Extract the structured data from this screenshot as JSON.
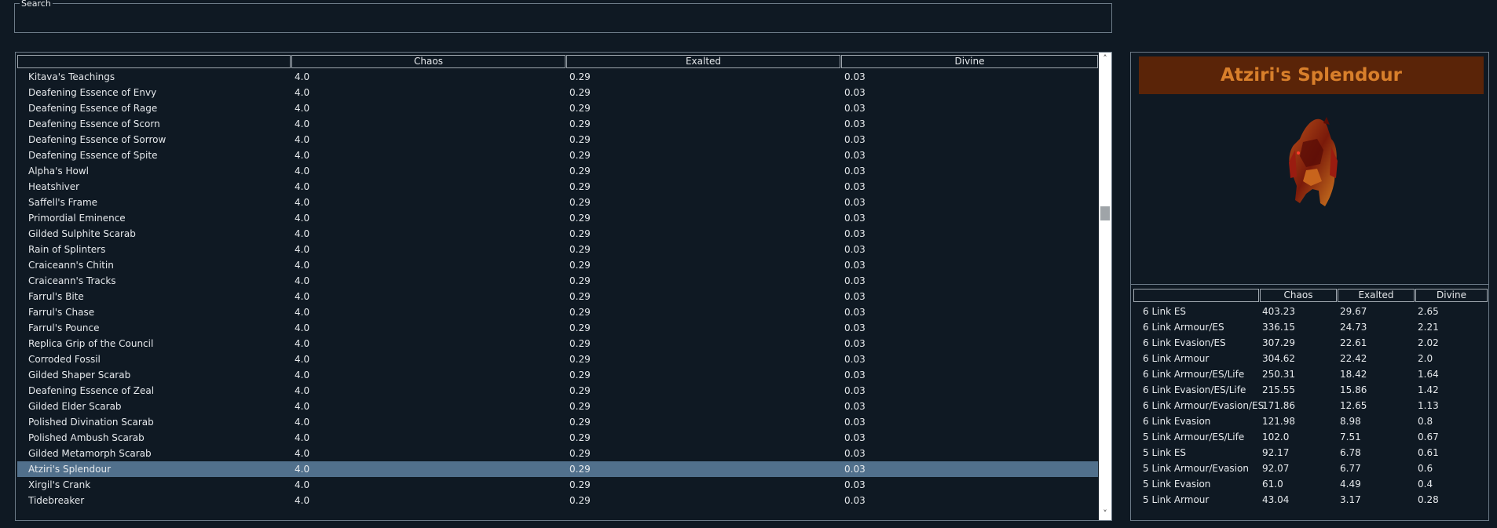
{
  "search": {
    "label": "Search",
    "value": ""
  },
  "main_table": {
    "columns": [
      "",
      "Chaos",
      "Exalted",
      "Divine"
    ],
    "rows": [
      {
        "name": "Kitava's Teachings",
        "chaos": "4.0",
        "exalted": "0.29",
        "divine": "0.03"
      },
      {
        "name": "Deafening Essence of Envy",
        "chaos": "4.0",
        "exalted": "0.29",
        "divine": "0.03"
      },
      {
        "name": "Deafening Essence of Rage",
        "chaos": "4.0",
        "exalted": "0.29",
        "divine": "0.03"
      },
      {
        "name": "Deafening Essence of Scorn",
        "chaos": "4.0",
        "exalted": "0.29",
        "divine": "0.03"
      },
      {
        "name": "Deafening Essence of Sorrow",
        "chaos": "4.0",
        "exalted": "0.29",
        "divine": "0.03"
      },
      {
        "name": "Deafening Essence of Spite",
        "chaos": "4.0",
        "exalted": "0.29",
        "divine": "0.03"
      },
      {
        "name": "Alpha's Howl",
        "chaos": "4.0",
        "exalted": "0.29",
        "divine": "0.03"
      },
      {
        "name": "Heatshiver",
        "chaos": "4.0",
        "exalted": "0.29",
        "divine": "0.03"
      },
      {
        "name": "Saffell's Frame",
        "chaos": "4.0",
        "exalted": "0.29",
        "divine": "0.03"
      },
      {
        "name": "Primordial Eminence",
        "chaos": "4.0",
        "exalted": "0.29",
        "divine": "0.03"
      },
      {
        "name": "Gilded Sulphite Scarab",
        "chaos": "4.0",
        "exalted": "0.29",
        "divine": "0.03"
      },
      {
        "name": "Rain of Splinters",
        "chaos": "4.0",
        "exalted": "0.29",
        "divine": "0.03"
      },
      {
        "name": "Craiceann's Chitin",
        "chaos": "4.0",
        "exalted": "0.29",
        "divine": "0.03"
      },
      {
        "name": "Craiceann's Tracks",
        "chaos": "4.0",
        "exalted": "0.29",
        "divine": "0.03"
      },
      {
        "name": "Farrul's Bite",
        "chaos": "4.0",
        "exalted": "0.29",
        "divine": "0.03"
      },
      {
        "name": "Farrul's Chase",
        "chaos": "4.0",
        "exalted": "0.29",
        "divine": "0.03"
      },
      {
        "name": "Farrul's Pounce",
        "chaos": "4.0",
        "exalted": "0.29",
        "divine": "0.03"
      },
      {
        "name": "Replica Grip of the Council",
        "chaos": "4.0",
        "exalted": "0.29",
        "divine": "0.03"
      },
      {
        "name": "Corroded Fossil",
        "chaos": "4.0",
        "exalted": "0.29",
        "divine": "0.03"
      },
      {
        "name": "Gilded Shaper Scarab",
        "chaos": "4.0",
        "exalted": "0.29",
        "divine": "0.03"
      },
      {
        "name": "Deafening Essence of Zeal",
        "chaos": "4.0",
        "exalted": "0.29",
        "divine": "0.03"
      },
      {
        "name": "Gilded Elder Scarab",
        "chaos": "4.0",
        "exalted": "0.29",
        "divine": "0.03"
      },
      {
        "name": "Polished Divination Scarab",
        "chaos": "4.0",
        "exalted": "0.29",
        "divine": "0.03"
      },
      {
        "name": "Polished Ambush Scarab",
        "chaos": "4.0",
        "exalted": "0.29",
        "divine": "0.03"
      },
      {
        "name": "Gilded Metamorph Scarab",
        "chaos": "4.0",
        "exalted": "0.29",
        "divine": "0.03"
      },
      {
        "name": "Atziri's Splendour",
        "chaos": "4.0",
        "exalted": "0.29",
        "divine": "0.03",
        "selected": true
      },
      {
        "name": "Xirgil's Crank",
        "chaos": "4.0",
        "exalted": "0.29",
        "divine": "0.03"
      },
      {
        "name": "Tidebreaker",
        "chaos": "4.0",
        "exalted": "0.29",
        "divine": "0.03"
      }
    ]
  },
  "scrollbar": {
    "up_icon": "scroll-up-arrow-icon",
    "down_icon": "scroll-down-arrow-icon",
    "position": 0.33
  },
  "detail": {
    "title": "Atziri's Splendour",
    "title_color": "#d87f2b",
    "title_bg": "#5a2408",
    "image_icon": "armour-item-icon",
    "columns": [
      "",
      "Chaos",
      "Exalted",
      "Divine"
    ],
    "rows": [
      {
        "name": "6 Link ES",
        "chaos": "403.23",
        "exalted": "29.67",
        "divine": "2.65"
      },
      {
        "name": "6 Link Armour/ES",
        "chaos": "336.15",
        "exalted": "24.73",
        "divine": "2.21"
      },
      {
        "name": "6 Link Evasion/ES",
        "chaos": "307.29",
        "exalted": "22.61",
        "divine": "2.02"
      },
      {
        "name": "6 Link Armour",
        "chaos": "304.62",
        "exalted": "22.42",
        "divine": "2.0"
      },
      {
        "name": "6 Link Armour/ES/Life",
        "chaos": "250.31",
        "exalted": "18.42",
        "divine": "1.64"
      },
      {
        "name": "6 Link Evasion/ES/Life",
        "chaos": "215.55",
        "exalted": "15.86",
        "divine": "1.42"
      },
      {
        "name": "6 Link Armour/Evasion/ES",
        "chaos": "171.86",
        "exalted": "12.65",
        "divine": "1.13"
      },
      {
        "name": "6 Link Evasion",
        "chaos": "121.98",
        "exalted": "8.98",
        "divine": "0.8"
      },
      {
        "name": "5 Link Armour/ES/Life",
        "chaos": "102.0",
        "exalted": "7.51",
        "divine": "0.67"
      },
      {
        "name": "5 Link ES",
        "chaos": "92.17",
        "exalted": "6.78",
        "divine": "0.61"
      },
      {
        "name": "5 Link Armour/Evasion",
        "chaos": "92.07",
        "exalted": "6.77",
        "divine": "0.6"
      },
      {
        "name": "5 Link Evasion",
        "chaos": "61.0",
        "exalted": "4.49",
        "divine": "0.4"
      },
      {
        "name": "5 Link Armour",
        "chaos": "43.04",
        "exalted": "3.17",
        "divine": "0.28"
      }
    ]
  },
  "colors": {
    "background": "#0f1923",
    "selected_row": "#51708c",
    "border": "#6c7a87"
  }
}
